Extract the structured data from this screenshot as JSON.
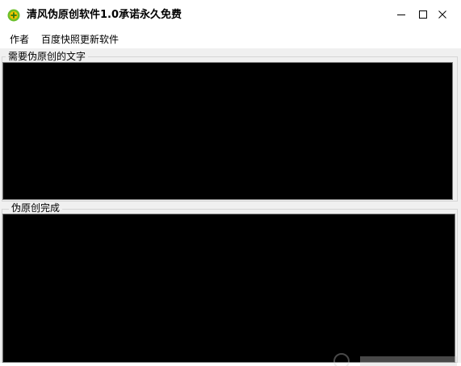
{
  "window": {
    "title": "清风伪原创软件1.0承诺永久免费"
  },
  "menu": {
    "items": [
      {
        "label": "作者"
      },
      {
        "label": "百度快照更新软件"
      }
    ]
  },
  "input_group": {
    "label": "需要伪原创的文字",
    "value": ""
  },
  "output_group": {
    "label": "伪原创完成",
    "value": ""
  },
  "colors": {
    "textarea_bg": "#000000",
    "window_bg": "#f0f0f0",
    "icon_green": "#6cbf2b",
    "icon_yellow": "#f5c400"
  }
}
